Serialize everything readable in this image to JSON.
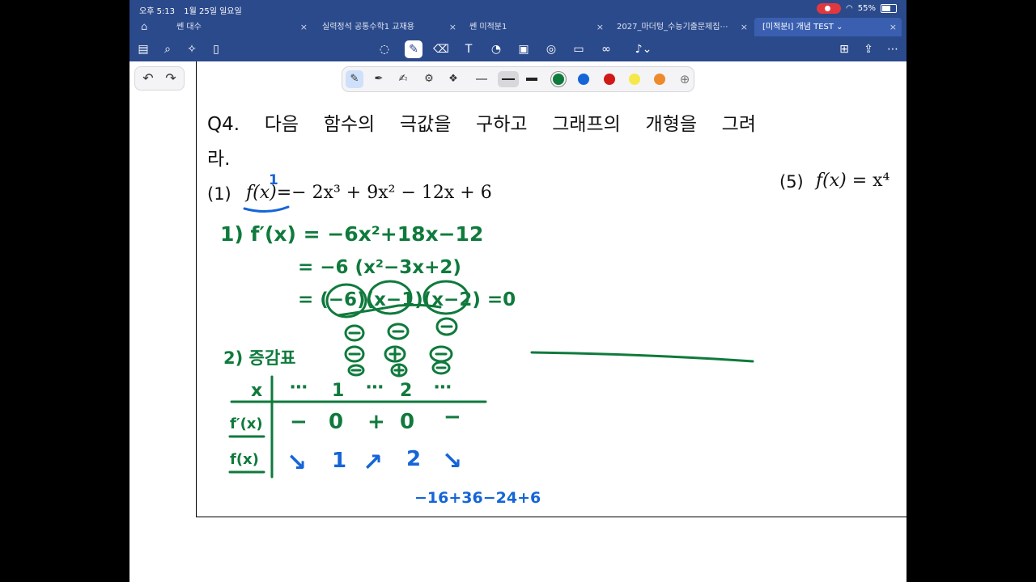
{
  "status": {
    "time": "오후 5:13",
    "date": "1월 25일 일요일",
    "battery": "55%",
    "battery_level": 0.55
  },
  "tabs": [
    {
      "label": "쎈 대수"
    },
    {
      "label": "실력정석 공통수학1 교재용"
    },
    {
      "label": "쎈 미적분1"
    },
    {
      "label": "2027_마더텅_수능기출문제집⋯"
    },
    {
      "label": "[미적분I] 개념 TEST ⌄"
    }
  ],
  "icons": {
    "close": "×",
    "home": "⌂",
    "undo": "↶",
    "redo": "↷"
  },
  "colors": {
    "accent": "#2b4a8b",
    "ink_green": "#0f7a3c",
    "ink_blue": "#1565d8",
    "pen_red": "#d01818",
    "pen_yellow": "#f5e94a",
    "pen_orange": "#ee8a2c"
  },
  "page": {
    "question": "Q4. 다음 함수의 극값을 구하고 그래프의 개형을 그려",
    "question_cont": "라.",
    "part1_label": "(1)",
    "part1_eq": {
      "fx": "f(x)",
      "rhs": "=− 2x³ + 9x² − 12x + 6"
    },
    "part5_label": "(5)",
    "part5_eq": {
      "fx": "f(x)",
      "rhs": " = x⁴"
    }
  },
  "handwriting": {
    "step1": "1) f′(x) = −6x²+18x−12",
    "line2": "= −6 (x²−3x+2)",
    "line3": "= (−6)(x−1)(x−2) =0",
    "step2": "2) 증감표",
    "table_header": [
      "x",
      "⋯",
      "1",
      "⋯",
      "2",
      "⋯"
    ],
    "row_fprime": [
      "f′(x)",
      "−",
      "0",
      "+",
      "0",
      "−"
    ],
    "row_f": [
      "f(x)",
      "↘",
      "1",
      "↗",
      "2",
      "↘"
    ],
    "calc": "−16+36−24+6",
    "annotation": "1"
  }
}
